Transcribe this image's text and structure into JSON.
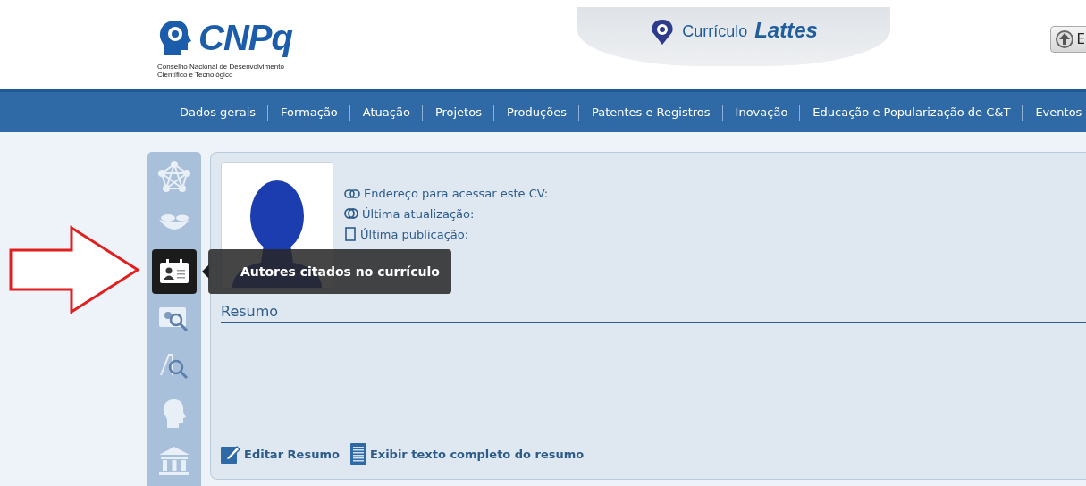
{
  "header": {
    "logo": {
      "name": "CNPq",
      "subtitle_lines": [
        "Conselho Nacional de Desenvolvimento",
        "Científico e Tecnológico"
      ]
    },
    "banner": {
      "prefix": "Currículo",
      "name": "Lattes"
    },
    "language_button": {
      "label": "E"
    }
  },
  "nav": {
    "items": [
      "Dados gerais",
      "Formação",
      "Atuação",
      "Projetos",
      "Produções",
      "Patentes e Registros",
      "Inovação",
      "Educação e Popularização de C&T",
      "Eventos"
    ]
  },
  "sidebar": {
    "items": [
      {
        "kind": "network",
        "selected": false
      },
      {
        "kind": "bowl",
        "selected": false
      },
      {
        "kind": "contact-card",
        "selected": true
      },
      {
        "kind": "profile-search",
        "selected": false
      },
      {
        "kind": "text-search",
        "selected": false
      },
      {
        "kind": "head",
        "selected": false
      },
      {
        "kind": "building",
        "selected": false
      }
    ],
    "tooltip": "Autores citados no currículo"
  },
  "profile": {
    "info": [
      {
        "kind": "link",
        "label": "Endereço para acessar este CV:"
      },
      {
        "kind": "update",
        "label": "Última atualização:"
      },
      {
        "kind": "publication",
        "label": "Última publicação:"
      }
    ]
  },
  "summary": {
    "title": "Resumo",
    "actions": [
      {
        "kind": "edit",
        "label": "Editar Resumo"
      },
      {
        "kind": "document",
        "label": "Exibir texto completo do resumo"
      }
    ]
  }
}
